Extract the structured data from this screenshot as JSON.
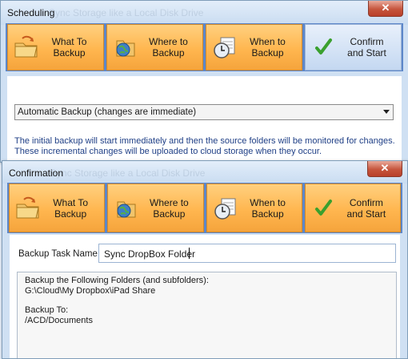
{
  "back_window": {
    "title": "Scheduling",
    "ghost_text": "Sync Storage like a Local Disk Drive",
    "close_glyph": "✕",
    "nav": [
      {
        "line1": "What To",
        "line2": "Backup",
        "icon": "folder-backup-icon"
      },
      {
        "line1": "Where to",
        "line2": "Backup",
        "icon": "globe-folder-icon"
      },
      {
        "line1": "When to",
        "line2": "Backup",
        "icon": "clock-calendar-icon"
      },
      {
        "line1": "Confirm",
        "line2": "and Start",
        "icon": "checkmark-icon"
      }
    ],
    "active_step": 3,
    "schedule_select": "Automatic Backup (changes are immediate)",
    "description_line1": "The initial backup will start immediately and then the source folders will be monitored for changes.",
    "description_line2": "These incremental changes will be uploaded to cloud storage when they occur."
  },
  "front_window": {
    "title": "Confirmation",
    "ghost_text": "Sync Storage like a Local Disk Drive",
    "close_glyph": "✕",
    "nav": [
      {
        "line1": "What To",
        "line2": "Backup",
        "icon": "folder-backup-icon"
      },
      {
        "line1": "Where to",
        "line2": "Backup",
        "icon": "globe-folder-icon"
      },
      {
        "line1": "When to",
        "line2": "Backup",
        "icon": "clock-calendar-icon"
      },
      {
        "line1": "Confirm",
        "line2": "and Start",
        "icon": "checkmark-icon"
      }
    ],
    "active_step": 3,
    "task_name_label": "Backup Task Name",
    "task_name_value": "Sync DropBox Folder",
    "summary": {
      "folders_heading": "Backup the Following Folders (and subfolders):",
      "folder_path": "G:\\Cloud\\My Dropbox\\iPad Share",
      "to_heading": "Backup To:",
      "to_path": "/ACD/Documents"
    }
  },
  "colors": {
    "nav_orange": "#ffb64f",
    "nav_active": "#c4d8f1",
    "nav_strip": "#5d87c9",
    "description_text": "#1f3f86",
    "close_red": "#c6553d"
  }
}
